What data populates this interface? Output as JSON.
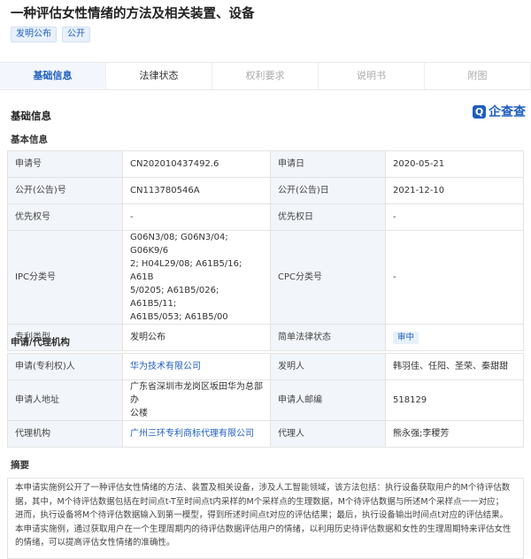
{
  "title": "一种评估女性情绪的方法及相关装置、设备",
  "tags": [
    "发明公布",
    "公开"
  ],
  "tabs": [
    "基础信息",
    "法律状态",
    "权利要求",
    "说明书",
    "附图"
  ],
  "section_title": "基础信息",
  "logo_text": "企查查",
  "basic_title": "基本信息",
  "basic": {
    "app_no_label": "申请号",
    "app_no": "CN202010437492.6",
    "app_date_label": "申请日",
    "app_date": "2020-05-21",
    "pub_no_label": "公开(公告)号",
    "pub_no": "CN113780546A",
    "pub_date_label": "公开(公告)日",
    "pub_date": "2021-12-10",
    "priority_no_label": "优先权号",
    "priority_no": "-",
    "priority_date_label": "优先权日",
    "priority_date": "-",
    "ipc_label": "IPC分类号",
    "ipc_lines": [
      "G06N3/08; G06N3/04; G06K9/6",
      "2; H04L29/08; A61B5/16; A61B",
      "5/0205; A61B5/026; A61B5/11;",
      "A61B5/053; A61B5/00"
    ],
    "cpc_label": "CPC分类号",
    "cpc": "-",
    "type_label": "专利类型",
    "type": "发明公布",
    "status_label": "简单法律状态",
    "status": "审中"
  },
  "agency_title": "申请/代理机构",
  "agency": {
    "applicant_label": "申请(专利权)人",
    "applicant": "华为技术有限公司",
    "inventor_label": "发明人",
    "inventor": "韩羽佳、任阳、圣荣、秦甜甜",
    "address_label": "申请人地址",
    "address_lines": [
      "广东省深圳市龙岗区坂田华为总部办",
      "公楼"
    ],
    "zip_label": "申请人邮编",
    "zip": "518129",
    "agent_org_label": "代理机构",
    "agent_org": "广州三环专利商标代理有限公司",
    "agent_label": "代理人",
    "agent": "熊永强;李稷芳"
  },
  "abstract_title": "摘要",
  "abstract_lines": [
    "本申请实施例公开了一种评估女性情绪的方法、装置及相关设备，涉及人工智能领域，该方法包括：执行设备获取用户的M个待评估数",
    "据，其中，M个待评估数据包括在时间点t-T至时间点t内采样的M个采样点的生理数据，M个待评估数据与所述M个采样点一一对应；",
    "进而，执行设备将M个待评估数据输入到第一模型，得到所述时间点t对应的评估结果；最后，执行设备输出时间点t对应的评估结果。",
    "本申请实施例，通过获取用户在一个生理周期内的待评估数据评估用户的情绪，以利用历史待评估数据和女性的生理周期特来评估女性",
    "的情绪，可以提高评估女性情绪的准确性。"
  ]
}
